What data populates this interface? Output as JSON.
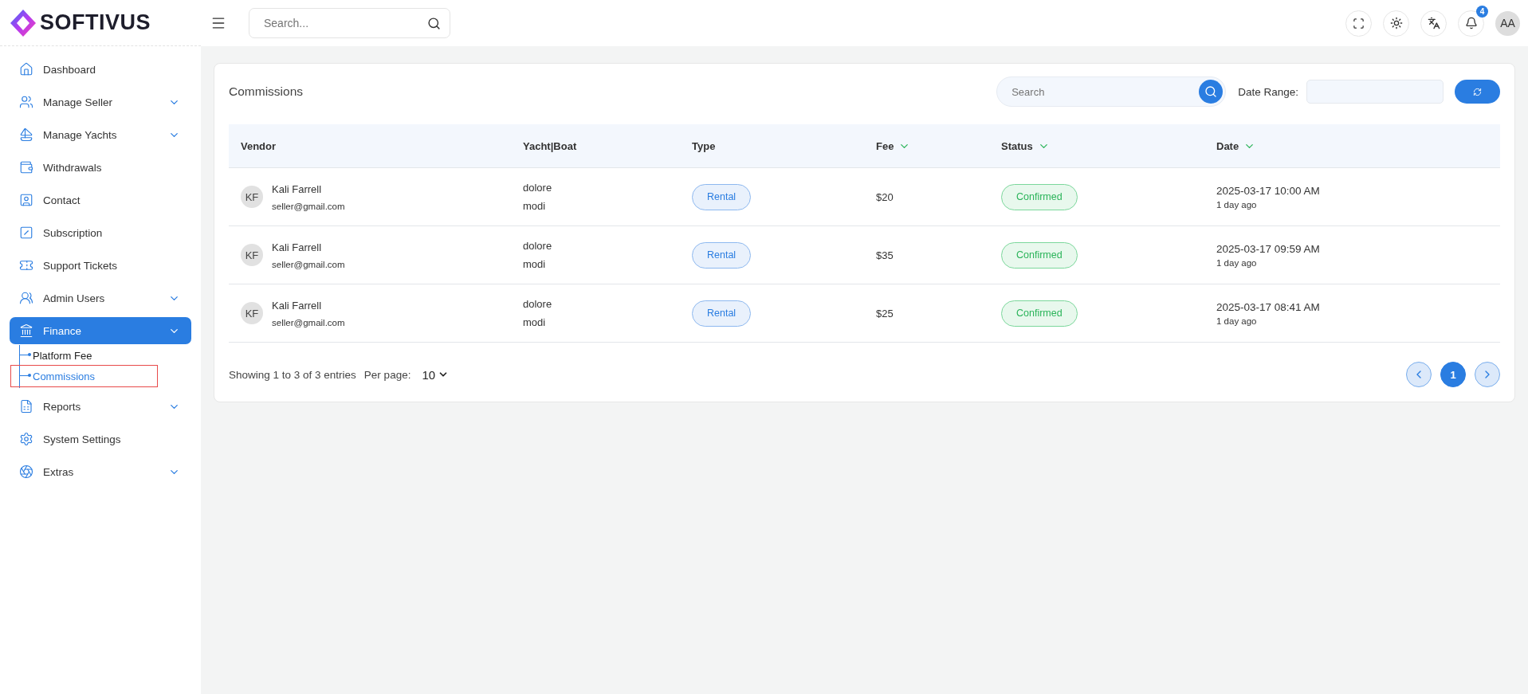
{
  "header": {
    "logo_text": "SOFTIVUS",
    "search": {
      "placeholder": "Search..."
    },
    "notification_count": "4",
    "avatar": "AA"
  },
  "sidebar": {
    "items": [
      {
        "label": "Dashboard",
        "has_submenu": false,
        "selected": false
      },
      {
        "label": "Manage Seller",
        "has_submenu": true,
        "selected": false
      },
      {
        "label": "Manage Yachts",
        "has_submenu": true,
        "selected": false
      },
      {
        "label": "Withdrawals",
        "has_submenu": false,
        "selected": false
      },
      {
        "label": "Contact",
        "has_submenu": false,
        "selected": false
      },
      {
        "label": "Subscription",
        "has_submenu": false,
        "selected": false
      },
      {
        "label": "Support Tickets",
        "has_submenu": false,
        "selected": false
      },
      {
        "label": "Admin Users",
        "has_submenu": true,
        "selected": false
      },
      {
        "label": "Finance",
        "has_submenu": true,
        "selected": true,
        "children": [
          {
            "label": "Platform Fee",
            "selected": false
          },
          {
            "label": "Commissions",
            "selected": true
          }
        ]
      },
      {
        "label": "Reports",
        "has_submenu": true,
        "selected": false
      },
      {
        "label": "System Settings",
        "has_submenu": false,
        "selected": false
      },
      {
        "label": "Extras",
        "has_submenu": true,
        "selected": false
      }
    ]
  },
  "card": {
    "title": "Commissions",
    "search": {
      "placeholder": "Search"
    },
    "date_range_label": "Date Range:",
    "table": {
      "columns": [
        {
          "label": "Vendor",
          "sortable": false
        },
        {
          "label": "Yacht|Boat",
          "sortable": false
        },
        {
          "label": "Type",
          "sortable": false
        },
        {
          "label": "Fee",
          "sortable": true
        },
        {
          "label": "Status",
          "sortable": true
        },
        {
          "label": "Date",
          "sortable": true
        }
      ],
      "rows": [
        {
          "initials": "KF",
          "vendor": "Kali Farrell",
          "email": "seller@gmail.com",
          "yacht": "dolore",
          "boat": "modi",
          "type": "Rental",
          "fee": "$20",
          "status": "Confirmed",
          "date": "2025-03-17 10:00 AM",
          "ago": "1 day ago"
        },
        {
          "initials": "KF",
          "vendor": "Kali Farrell",
          "email": "seller@gmail.com",
          "yacht": "dolore",
          "boat": "modi",
          "type": "Rental",
          "fee": "$35",
          "status": "Confirmed",
          "date": "2025-03-17 09:59 AM",
          "ago": "1 day ago"
        },
        {
          "initials": "KF",
          "vendor": "Kali Farrell",
          "email": "seller@gmail.com",
          "yacht": "dolore",
          "boat": "modi",
          "type": "Rental",
          "fee": "$25",
          "status": "Confirmed",
          "date": "2025-03-17 08:41 AM",
          "ago": "1 day ago"
        }
      ]
    },
    "footer": {
      "showing": "Showing 1 to 3 of 3 entries",
      "per_page_label": "Per page:",
      "per_page": "10",
      "pages": [
        {
          "label": "1",
          "selected": true
        }
      ]
    }
  }
}
